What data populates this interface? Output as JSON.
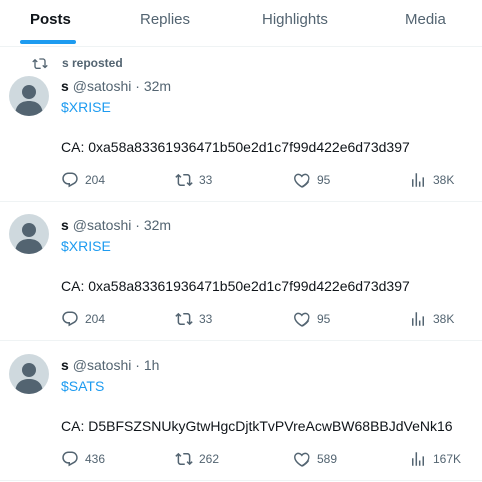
{
  "tabs": [
    "Posts",
    "Replies",
    "Highlights",
    "Media"
  ],
  "posts": [
    {
      "repost_label": "s reposted",
      "name": "s",
      "handle": "@satoshi",
      "time": "· 32m",
      "ticker": "$XRISE",
      "ca": "CA:  0xa58a83361936471b50e2d1c7f99d422e6d73d397",
      "replies": "204",
      "reposts": "33",
      "likes": "95",
      "views": "38K"
    },
    {
      "name": "s",
      "handle": "@satoshi",
      "time": "· 32m",
      "ticker": "$XRISE",
      "ca": "CA:  0xa58a83361936471b50e2d1c7f99d422e6d73d397",
      "replies": "204",
      "reposts": "33",
      "likes": "95",
      "views": "38K"
    },
    {
      "name": "s",
      "handle": "@satoshi",
      "time": "· 1h",
      "ticker": "$SATS",
      "ca": "CA: D5BFSZSNUkyGtwHgcDjtkTvPVreAcwBW68BBJdVeNk16",
      "replies": "436",
      "reposts": "262",
      "likes": "589",
      "views": "167K"
    }
  ],
  "colors": {
    "accent": "#1d9bf0",
    "muted": "#536471",
    "text": "#0f1419",
    "divider": "#eff3f4",
    "avatar_bg": "#cfd9de"
  }
}
